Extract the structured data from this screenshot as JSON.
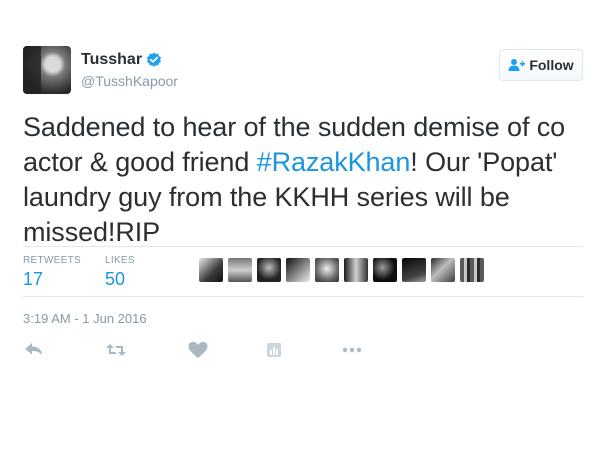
{
  "user": {
    "name": "Tusshar",
    "handle": "@TusshKapoor"
  },
  "follow_button": {
    "label": "Follow"
  },
  "tweet": {
    "text_part1": "Saddened to hear of the sudden demise of co actor & good friend ",
    "hashtag": "#RazakKhan",
    "text_part2": "! Our 'Popat' laundry guy from the KKHH series will be missed!RIP"
  },
  "stats": {
    "retweets_label": "RETWEETS",
    "retweets_value": "17",
    "likes_label": "LIKES",
    "likes_value": "50"
  },
  "timestamp": "3:19 AM - 1 Jun 2016",
  "colors": {
    "link": "#1b95e0",
    "text": "#292f33",
    "muted": "#8899a6",
    "verified": "#1da1f2"
  },
  "icons": {
    "verified": "verified-badge-icon",
    "follow": "add-person-icon",
    "reply": "reply-icon",
    "retweet": "retweet-icon",
    "like": "heart-icon",
    "stats": "analytics-icon",
    "more": "more-dots-icon"
  }
}
